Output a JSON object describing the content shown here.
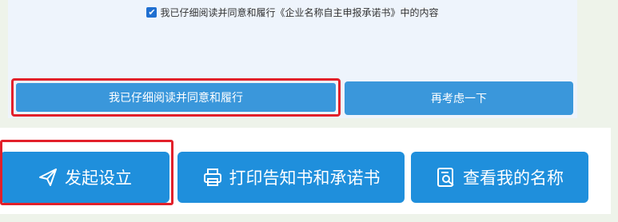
{
  "agreement": {
    "checked": true,
    "checkbox_mark": "✔",
    "text": "我已仔细阅读并同意和履行《企业名称自主申报承诺书》中的内容"
  },
  "dialog_buttons": {
    "confirm_label": "我已仔细阅读并同意和履行",
    "reconsider_label": "再考虑一下"
  },
  "actions": {
    "start_label": "发起设立",
    "print_label": "打印告知书和承诺书",
    "view_name_label": "查看我的名称"
  },
  "icons": {
    "start": "paper-plane-icon",
    "print": "printer-icon",
    "view_name": "document-search-icon"
  },
  "colors": {
    "button_blue": "#1f8fdc",
    "dialog_button_blue": "#3a97db",
    "highlight_red": "#e2202a",
    "checkbox_blue": "#1f6fd1"
  }
}
